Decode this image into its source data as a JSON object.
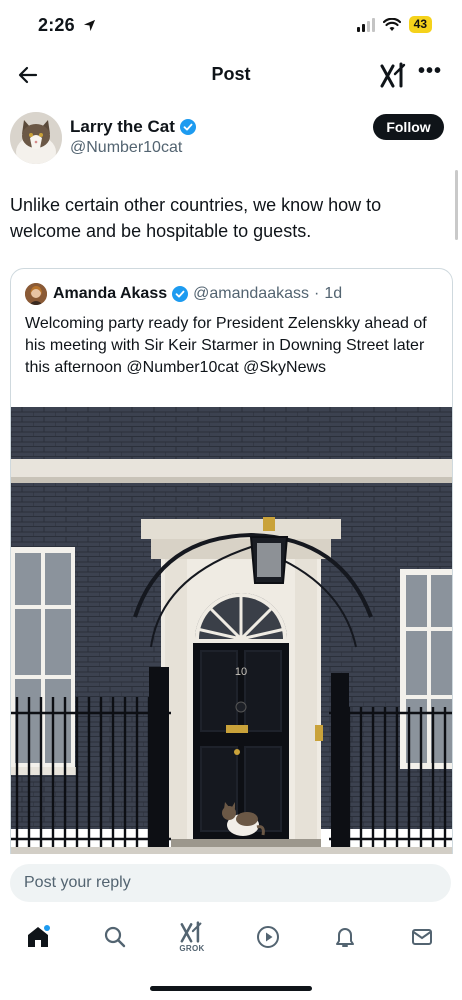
{
  "status": {
    "time": "2:26",
    "battery": "43"
  },
  "header": {
    "title": "Post"
  },
  "author": {
    "name": "Larry the Cat",
    "handle": "@Number10cat",
    "follow_label": "Follow"
  },
  "post": {
    "text": "Unlike certain other countries, we know how to welcome and be hospitable to guests."
  },
  "quote": {
    "name": "Amanda Akass",
    "handle": "@amandaakass",
    "separator": "·",
    "time": "1d",
    "text": "Welcoming party ready for President Zelenskky ahead of his meeting with Sir Keir Starmer in Downing Street later this afternoon @Number10cat @SkyNews",
    "door_number": "10"
  },
  "reply": {
    "placeholder": "Post your reply"
  },
  "nav": {
    "grok_label": "GROK"
  },
  "colors": {
    "accent": "#1d9bf0",
    "text": "#0f1419",
    "muted": "#536471",
    "battery": "#f5d21b"
  },
  "icons": [
    "back-arrow-icon",
    "xai-icon",
    "more-icon",
    "verified-icon",
    "home-icon",
    "search-icon",
    "grok-icon",
    "video-icon",
    "bell-icon",
    "mail-icon"
  ]
}
